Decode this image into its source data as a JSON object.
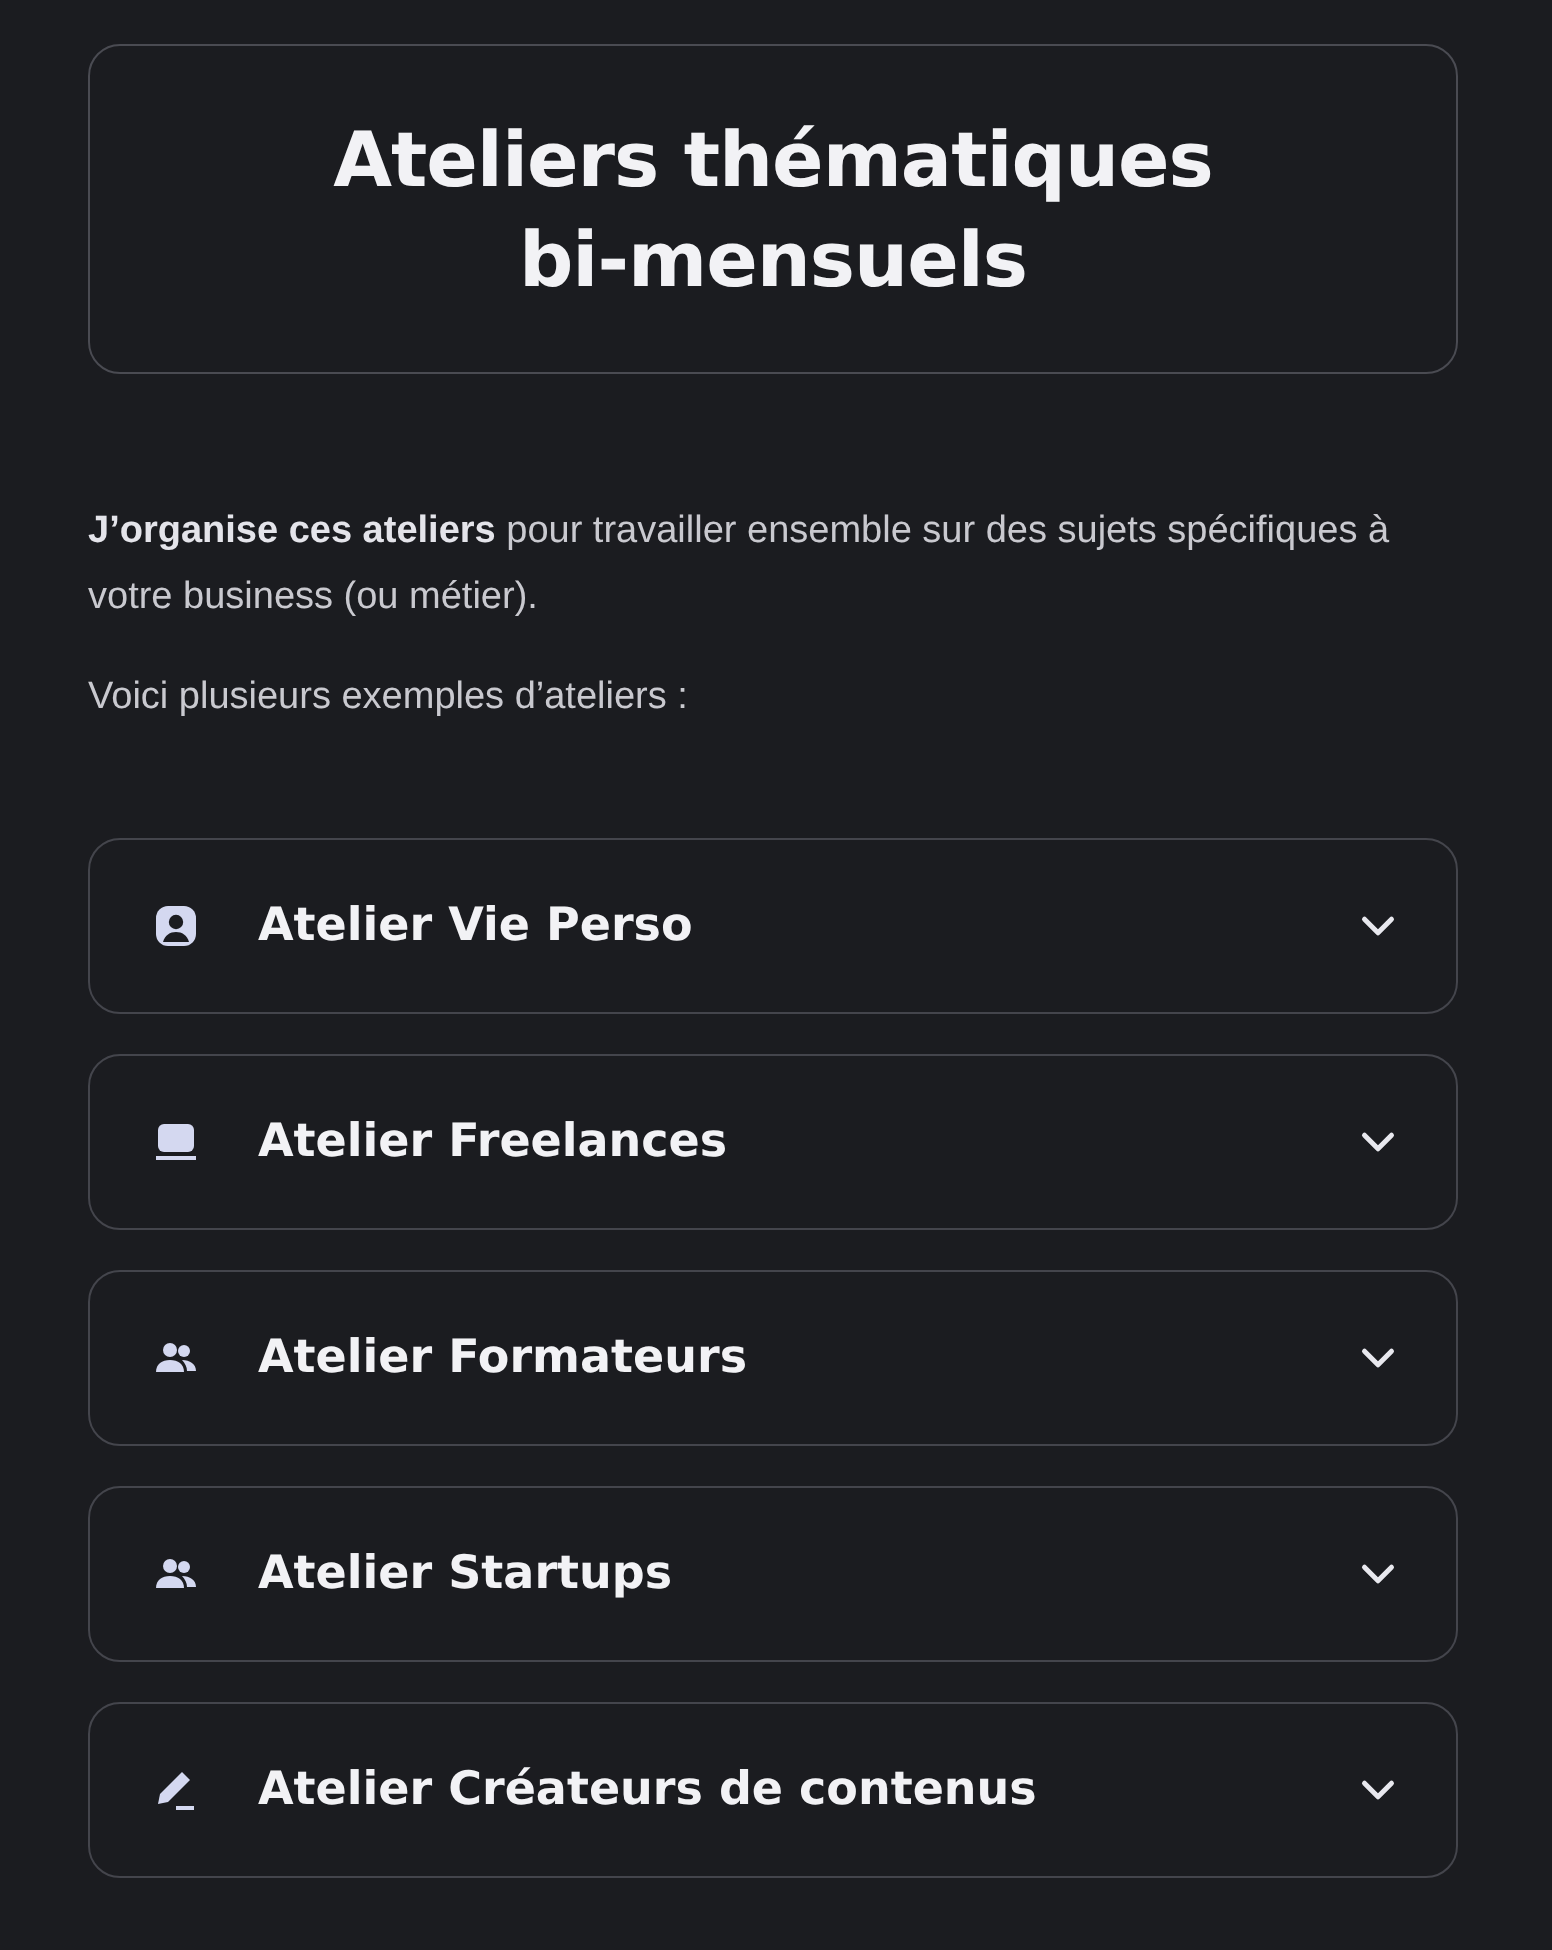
{
  "header": {
    "title": "Ateliers thématiques bi-mensuels"
  },
  "intro": [
    "**J’organise ces ateliers** pour travailler ensemble sur des sujets spécifiques à votre business (ou métier).",
    "Voici plusieurs exemples d’ateliers :"
  ],
  "accordion": [
    {
      "label": "Atelier Vie Perso",
      "kind": "person",
      "expanded": false
    },
    {
      "label": "Atelier Freelances",
      "kind": "laptop",
      "expanded": false
    },
    {
      "label": "Atelier Formateurs",
      "kind": "group",
      "expanded": false
    },
    {
      "label": "Atelier Startups",
      "kind": "group",
      "expanded": false
    },
    {
      "label": "Atelier Créateurs de contenus",
      "kind": "pencil",
      "expanded": false
    }
  ]
}
